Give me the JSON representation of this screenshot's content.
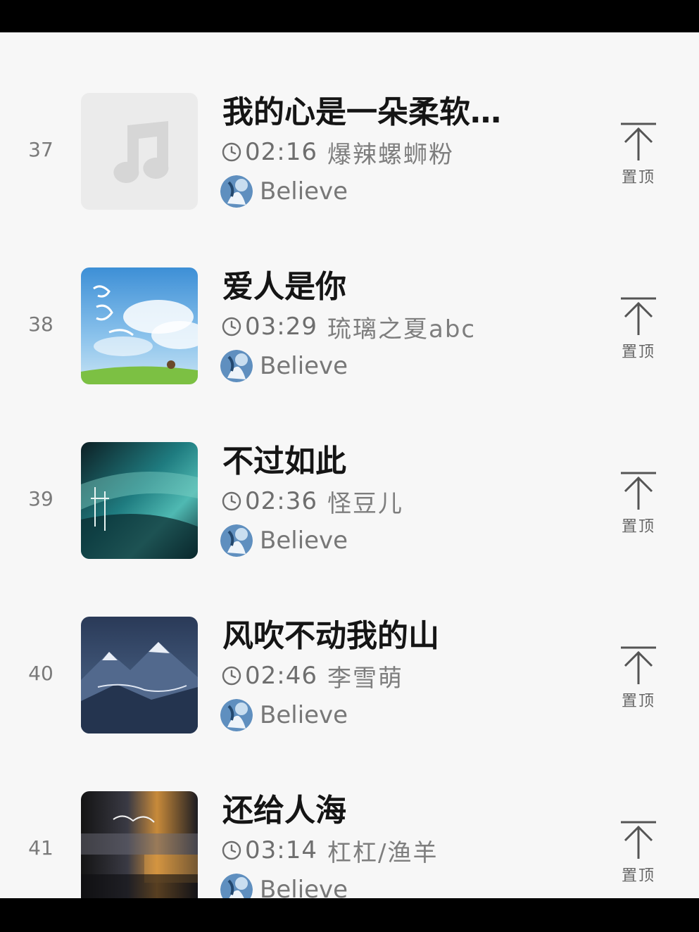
{
  "songs": [
    {
      "index": "37",
      "title": "我的心是一朵柔软…",
      "duration": "02:16",
      "artist": "爆辣螺蛳粉",
      "uploader": "Believe",
      "pin_label": "置顶",
      "cover": "placeholder"
    },
    {
      "index": "38",
      "title": "爱人是你",
      "duration": "03:29",
      "artist": "琉璃之夏abc",
      "uploader": "Believe",
      "pin_label": "置顶",
      "cover": "sky"
    },
    {
      "index": "39",
      "title": "不过如此",
      "duration": "02:36",
      "artist": "怪豆儿",
      "uploader": "Believe",
      "pin_label": "置顶",
      "cover": "teal-night"
    },
    {
      "index": "40",
      "title": "风吹不动我的山",
      "duration": "02:46",
      "artist": "李雪萌",
      "uploader": "Believe",
      "pin_label": "置顶",
      "cover": "mountains"
    },
    {
      "index": "41",
      "title": "还给人海",
      "duration": "03:14",
      "artist": "杠杠/渔羊",
      "uploader": "Believe",
      "pin_label": "置顶",
      "cover": "blur-lights"
    }
  ],
  "icons": {
    "clock": "clock-icon",
    "pin": "pin-to-top-icon",
    "placeholder": "music-note-icon"
  },
  "colors": {
    "background": "#f7f7f7",
    "title": "#151515",
    "secondary_text": "#7e7e7e"
  }
}
